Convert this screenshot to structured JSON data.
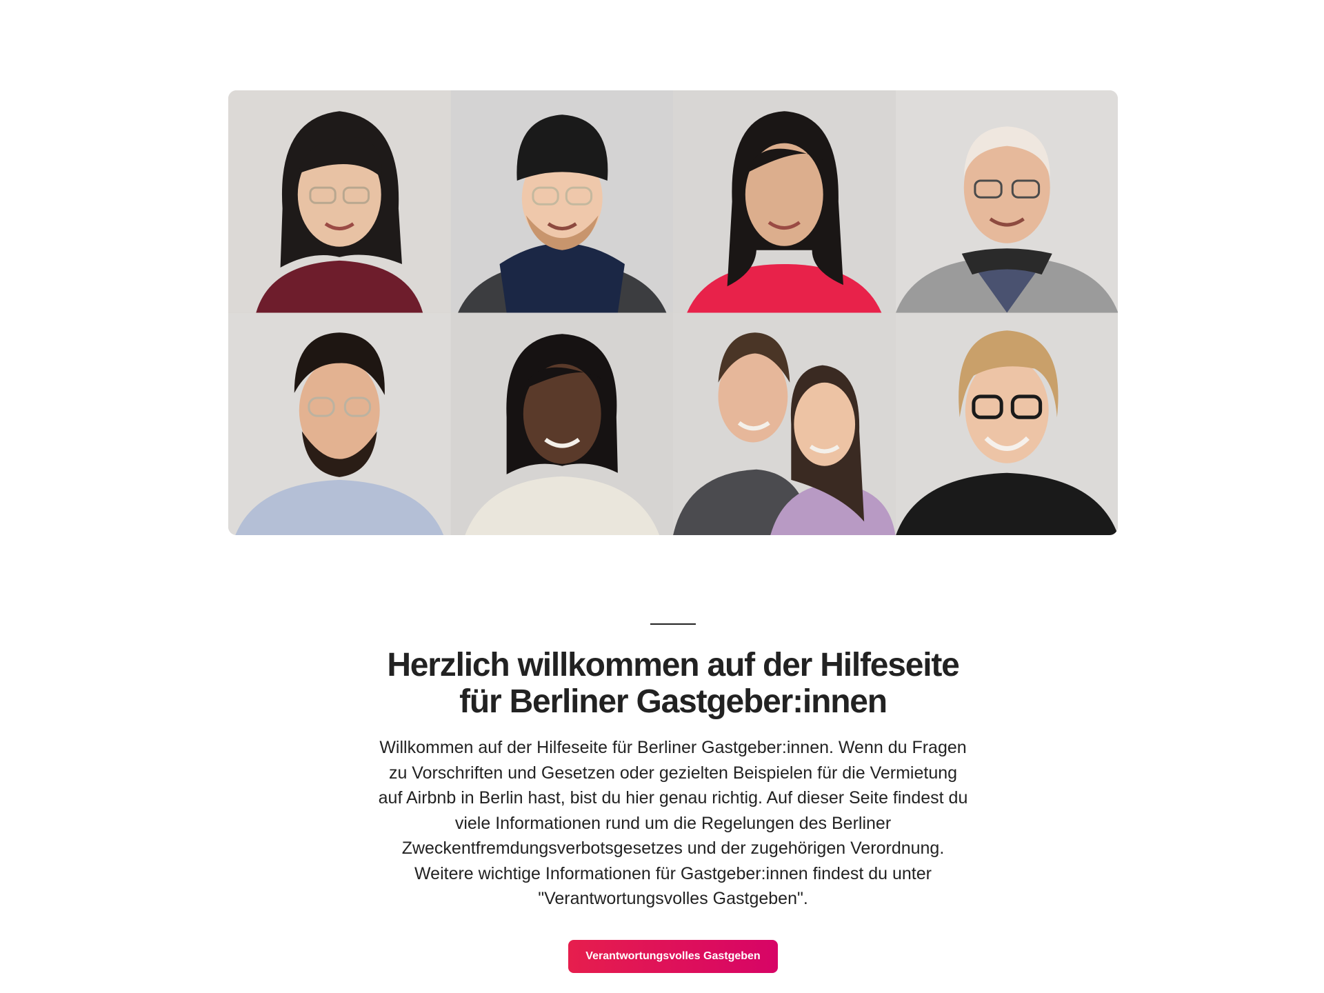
{
  "hero": {
    "photos": [
      {
        "name": "host-portrait-1"
      },
      {
        "name": "host-portrait-2"
      },
      {
        "name": "host-portrait-3"
      },
      {
        "name": "host-portrait-4"
      },
      {
        "name": "host-portrait-5"
      },
      {
        "name": "host-portrait-6"
      },
      {
        "name": "host-portrait-7"
      },
      {
        "name": "host-portrait-8"
      }
    ]
  },
  "main": {
    "title_line1": "Herzlich willkommen auf der Hilfeseite",
    "title_line2": "für Berliner Gastgeber:innen",
    "intro": "Willkommen auf der Hilfeseite für Berliner Gastgeber:innen. Wenn du Fragen zu Vorschriften und Gesetzen oder gezielten Beispielen für die Vermietung auf Airbnb in Berlin hast, bist du hier genau richtig. Auf dieser Seite findest du viele Informationen rund um die Regelungen des Berliner Zweckentfremdungsverbotsgesetzes und der zugehörigen Verordnung. Weitere wichtige Informationen für Gastgeber:innen findest du unter \"Verantwortungsvolles Gastgeben\".",
    "cta_label": "Verantwortungsvolles Gastgeben"
  },
  "colors": {
    "accent": "#e61e4d",
    "accent_end": "#d70466",
    "text": "#222222"
  }
}
